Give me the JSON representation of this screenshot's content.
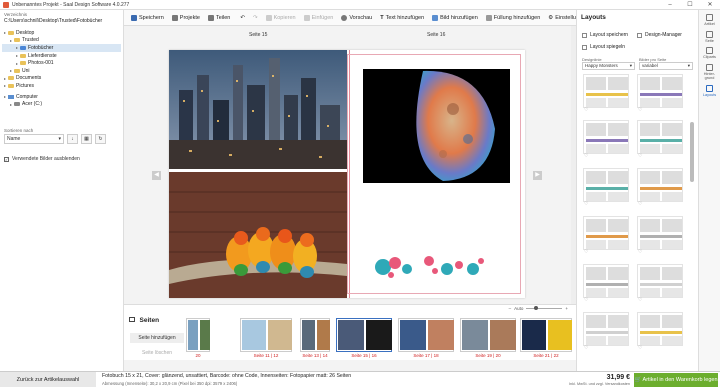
{
  "window": {
    "title": "Unbenanntes Projekt - Saal Design Software 4.0.277"
  },
  "left": {
    "dir_label": "Verzeichnis",
    "dir_path": "C:\\Users\\schnil\\Desktop\\Trusted\\Fotobücher",
    "tree": [
      {
        "label": "Desktop",
        "level": 0,
        "kind": "folder"
      },
      {
        "label": "Trusted",
        "level": 1,
        "kind": "folder"
      },
      {
        "label": "Fotobücher",
        "level": 2,
        "kind": "folder-blue",
        "selected": true
      },
      {
        "label": "Lieferdienste",
        "level": 2,
        "kind": "folder"
      },
      {
        "label": "Photos-001",
        "level": 2,
        "kind": "folder"
      },
      {
        "label": "Uni",
        "level": 1,
        "kind": "folder"
      },
      {
        "label": "Documents",
        "level": 0,
        "kind": "folder"
      },
      {
        "label": "Pictures",
        "level": 0,
        "kind": "folder"
      },
      {
        "label": "Computer",
        "level": 0,
        "kind": "pc"
      },
      {
        "label": "Acer (C:)",
        "level": 1,
        "kind": "drive"
      }
    ],
    "sort_label": "Sortieren nach",
    "sort_value": "Name",
    "hide_used": "Verwendete Bilder ausblenden"
  },
  "toolbar": {
    "save": "Speichern",
    "projects": "Projekte",
    "share": "Teilen",
    "copy": "Kopieren",
    "paste": "Einfügen",
    "preview": "Vorschau",
    "add_text": "Text hinzufügen",
    "add_image": "Bild hinzufügen",
    "add_fill": "Füllung hinzufügen",
    "settings": "Einstellungen"
  },
  "canvas": {
    "left_page": "Seite 15",
    "right_page": "Seite 16"
  },
  "pages": {
    "title": "Seiten",
    "add_page": "Seite hinzufügen",
    "delete_page": "Seite löschen",
    "zoom_label": "Auto",
    "thumbs": [
      {
        "label": "20"
      },
      {
        "label": "Seite 11 | 12"
      },
      {
        "label": "Seite 13 | 14"
      },
      {
        "label": "Seite 15 | 16",
        "selected": true
      },
      {
        "label": "Seite 17 | 18"
      },
      {
        "label": "Seite 19 | 20"
      },
      {
        "label": "Seite 21 | 22"
      }
    ]
  },
  "right": {
    "title": "Layouts",
    "save_layout": "Layout speichern",
    "design_manager": "Design-Manager",
    "mirror_layout": "Layout spiegeln",
    "design_label": "Designlinie",
    "design_value": "Happy Monsters",
    "images_label": "Bilder pro Seite",
    "images_value": "variabel"
  },
  "rside": [
    {
      "label": "Artikel",
      "icon": "wrench-icon"
    },
    {
      "label": "Seite",
      "icon": "page-icon"
    },
    {
      "label": "Cliparts",
      "icon": "clipart-icon"
    },
    {
      "label": "Hinter-grund",
      "icon": "background-icon"
    },
    {
      "label": "Layouts",
      "icon": "layouts-icon",
      "active": true
    }
  ],
  "footer": {
    "back": "Zurück zur Artikelauswahl",
    "summary": "Fotobuch 15 x 21, Cover: glänzend, unsattiert, Barcode: ohne Code, Innenseiten: Fotopapier matt: 26 Seiten",
    "summary2": "Abmessung (Innenseite): 30,2 x 20,9 cm (Pixel bei 350 dpi: 3579 x 2406)",
    "price": "31,99 €",
    "price_note": "Inkl. MwSt. und zzgl. Versandkosten",
    "cart": "Artikel in den Warenkorb legen"
  }
}
